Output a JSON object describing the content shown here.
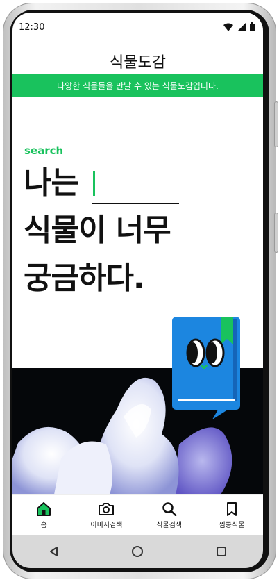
{
  "status_bar": {
    "time": "12:30"
  },
  "app": {
    "title": "식물도감"
  },
  "banner": {
    "text": "다양한 식물들을 만날 수 있는 식물도감입니다."
  },
  "hero": {
    "eyebrow": "search",
    "line1": "나는",
    "line2": "식물이 너무",
    "line3": "궁금하다."
  },
  "tabs": [
    {
      "label": "홈",
      "icon": "home-icon",
      "active": true
    },
    {
      "label": "이미지검색",
      "icon": "camera-icon"
    },
    {
      "label": "식물검색",
      "icon": "search-icon"
    },
    {
      "label": "찜콩식물",
      "icon": "bookmark-icon"
    }
  ],
  "colors": {
    "accent": "#19c25d",
    "mascot_blue": "#1c86e0",
    "text": "#111111"
  }
}
